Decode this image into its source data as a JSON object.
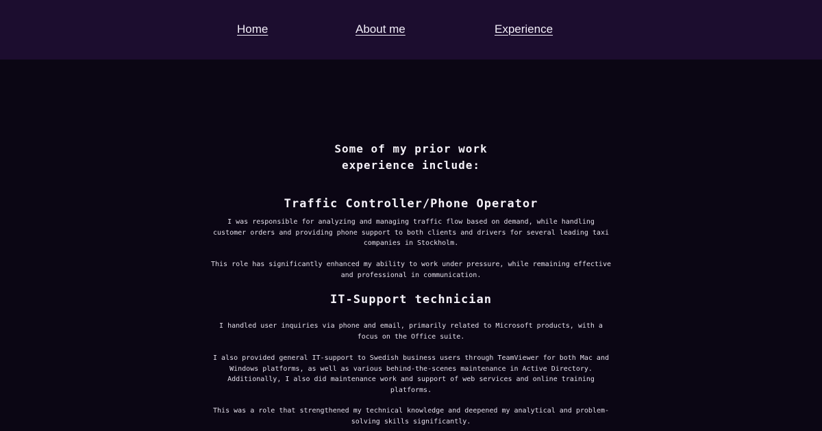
{
  "nav": {
    "home": "Home",
    "about": "About me",
    "experience": "Experience"
  },
  "main": {
    "intro_line1": "Some of my prior work",
    "intro_line2": "experience include:",
    "roles": [
      {
        "title": "Traffic Controller/Phone Operator",
        "paragraphs": [
          "I was responsible for analyzing and managing traffic flow based on demand, while handling customer orders and providing phone support to both clients and drivers for several leading taxi companies in Stockholm.",
          "This role has significantly enhanced my ability to work under pressure, while remaining effective and professional in communication."
        ]
      },
      {
        "title": "IT-Support technician",
        "paragraphs": [
          "I handled user inquiries via phone and email, primarily related to Microsoft products, with a focus on the Office suite.",
          "I also provided general IT-support to Swedish business users through TeamViewer for both Mac and Windows platforms, as well as various behind-the-scenes maintenance in Active Directory. Additionally, I also did maintenance work and support of web services and online training platforms.",
          "This was a role that strengthened my technical knowledge and deepened my analytical and problem-solving skills significantly."
        ]
      }
    ]
  }
}
